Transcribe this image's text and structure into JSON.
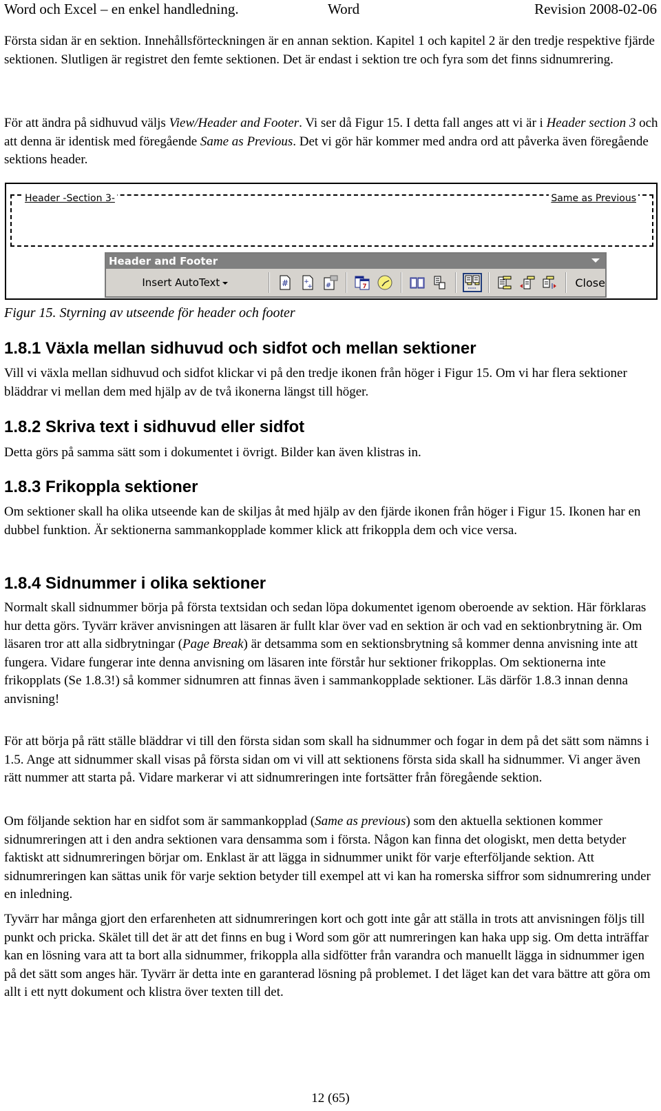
{
  "running_header": {
    "left": "Word och Excel – en enkel handledning.",
    "center": "Word",
    "right": "Revision 2008-02-06"
  },
  "intro": {
    "p1": "Första sidan är en sektion. Innehållsförteckningen är en annan sektion. Kapitel 1 och kapitel 2 är den tredje respektive fjärde sektionen. Slutligen är registret den femte sektionen. Det är endast i sektion tre och fyra som det finns sidnumrering.",
    "p2_a": "För att ändra på sidhuvud väljs ",
    "p2_i1": "View/Header and Footer",
    "p2_b": ". Vi ser då Figur 15. I detta fall anges att vi är i ",
    "p2_i2": "Header section 3",
    "p2_c": " och att denna är identisk med föregående ",
    "p2_i3": "Same as Previous",
    "p2_d": ". Det vi gör här kommer med andra ord att påverka även föregående sektions header."
  },
  "figure": {
    "header_label": "Header -Section 3-",
    "same_as_previous_label": "Same as Previous",
    "toolbar_title": "Header and Footer",
    "insert_autotext": "Insert AutoText",
    "close_label": "Close",
    "icons": [
      "insert-page-number-icon",
      "insert-number-of-pages-icon",
      "format-page-number-icon",
      "insert-date-icon",
      "insert-time-icon",
      "page-setup-icon",
      "show-hide-document-text-icon",
      "link-to-previous-icon",
      "switch-header-footer-icon",
      "show-previous-icon",
      "show-next-icon"
    ],
    "caption": "Figur 15. Styrning av utseende för header och footer"
  },
  "sections": [
    {
      "heading": "1.8.1 Växla mellan sidhuvud och sidfot och mellan sektioner",
      "text": "Vill vi växla mellan sidhuvud och sidfot klickar vi på den tredje ikonen från höger i Figur 15. Om vi har flera sektioner bläddrar vi mellan dem med hjälp av de två ikonerna längst till höger."
    },
    {
      "heading": "1.8.2 Skriva text i sidhuvud eller sidfot",
      "text": "Detta görs på samma sätt som i dokumentet i övrigt. Bilder kan även klistras in."
    },
    {
      "heading": "1.8.3 Frikoppla sektioner",
      "text": "Om sektioner skall ha olika utseende kan de skiljas åt med hjälp av den fjärde ikonen från höger i Figur 15. Ikonen har en dubbel funktion. Är sektionerna sammankopplade kommer klick att frikoppla dem och vice versa."
    },
    {
      "heading": "1.8.4 Sidnummer i olika sektioner",
      "p1_a": "Normalt skall sidnummer börja på första textsidan och sedan löpa dokumentet igenom oberoende av sektion. Här förklaras hur detta görs. Tyvärr kräver anvisningen att läsaren är fullt klar över vad en sektion är och vad en sektionbrytning är. Om läsaren tror att alla sidbrytningar (",
      "p1_i": "Page Break",
      "p1_b": ") är detsamma som en sektionsbrytning så kommer denna anvisning inte att fungera. Vidare fungerar inte denna anvisning om läsaren inte förstår hur sektioner frikopplas. Om sektionerna inte frikopplats (Se 1.8.3!) så kommer sidnumren att finnas även i sammankopplade sektioner. Läs därför 1.8.3 innan denna anvisning!",
      "p2": "För att börja på rätt ställe bläddrar vi till den första sidan som skall ha sidnummer och fogar in dem på det sätt som nämns i 1.5. Ange att sidnummer skall visas på första sidan om vi vill att sektionens första sida skall ha sidnummer. Vi anger även rätt nummer att starta på. Vidare markerar vi att sidnumreringen inte fortsätter från föregående sektion.",
      "p3_a": "Om följande sektion har en sidfot som är sammankopplad (",
      "p3_i": "Same as previous",
      "p3_b": ") som den aktuella sektionen kommer sidnumreringen att i den andra sektionen vara densamma som i första. Någon kan finna det ologiskt, men detta betyder faktiskt att sidnumreringen börjar om. Enklast är att lägga in sidnummer unikt för varje efterföljande sektion. Att sidnumreringen kan sättas unik för varje sektion betyder till exempel att vi kan ha romerska siffror som sidnumrering under en inledning.",
      "p4": "Tyvärr har många gjort den erfarenheten att sidnumreringen kort och gott inte går att ställa in trots att anvisningen följs till punkt och pricka. Skälet till det är att det finns en bug i Word som gör att numreringen kan haka upp sig. Om detta inträffar kan en lösning vara att ta bort alla sidnummer, frikoppla alla sidfötter från varandra och manuellt lägga in sidnummer igen på det sätt som anges här. Tyvärr är detta inte en garanterad lösning på problemet. I det läget kan det vara bättre att göra om allt i ett nytt dokument och klistra över texten till det."
    }
  ],
  "page_number": "12 (65)"
}
